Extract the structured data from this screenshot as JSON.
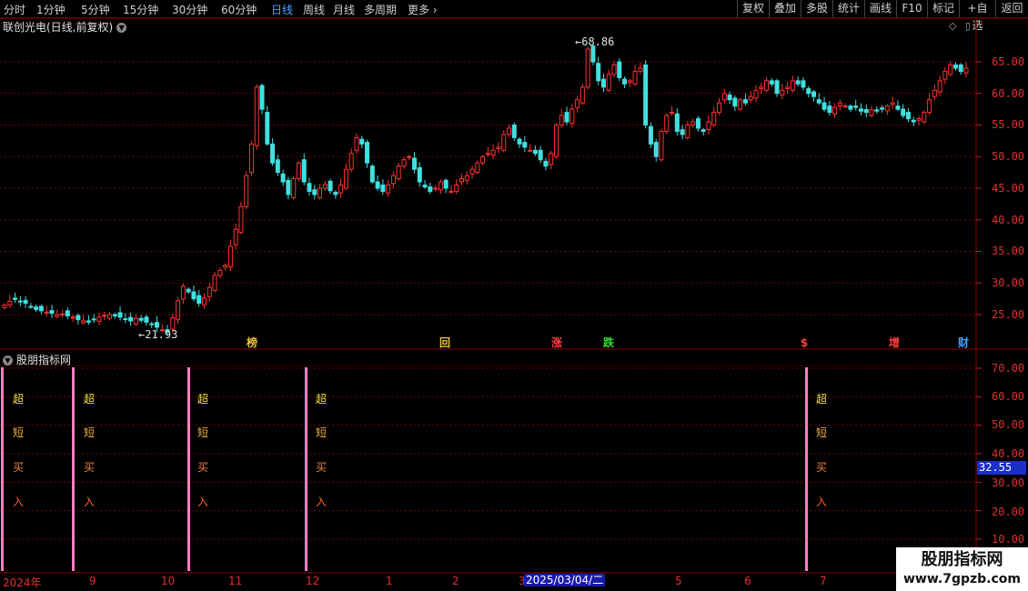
{
  "toolbar": {
    "periods": [
      "分时",
      "1分钟",
      "5分钟",
      "15分钟",
      "30分钟",
      "60分钟",
      "日线",
      "周线",
      "月线",
      "多周期",
      "更多"
    ],
    "active_period": "日线",
    "right_buttons": [
      "复权",
      "叠加",
      "多股",
      "统计",
      "画线",
      "F10",
      "标记",
      "+自选",
      "返回"
    ]
  },
  "chart_header": {
    "title": "联创光电(日线,前复权)"
  },
  "indicator_header": {
    "title": "股朋指标网"
  },
  "price_axis": [
    "65.00",
    "60.00",
    "55.00",
    "50.00",
    "45.00",
    "40.00",
    "35.00",
    "30.00",
    "25.00"
  ],
  "indicator_axis": [
    "70.00",
    "60.00",
    "50.00",
    "40.00",
    "30.00",
    "20.00",
    "10.00"
  ],
  "cursor_value": "32.55",
  "high_note": "68.86",
  "low_note": "21.93",
  "event_badges": [
    {
      "label": "榜",
      "color": "#e8c040"
    },
    {
      "label": "回",
      "color": "#e8c040"
    },
    {
      "label": "涨",
      "color": "#ff4040"
    },
    {
      "label": "跌",
      "color": "#30e030"
    },
    {
      "label": "$",
      "color": "#ff4040"
    },
    {
      "label": "增",
      "color": "#ff4040"
    },
    {
      "label": "财",
      "color": "#40a0ff"
    }
  ],
  "signal_text": [
    "超",
    "短",
    "买",
    "入"
  ],
  "signal_colors": [
    "#f0e040",
    "#f0b040",
    "#f08040",
    "#f06030"
  ],
  "x_axis": [
    "2024年",
    "9",
    "10",
    "11",
    "12",
    "1",
    "2",
    "3",
    "4",
    "5",
    "6",
    "7"
  ],
  "cursor_date": "2025/03/04/二",
  "watermark": {
    "line1": "股朋指标网",
    "line2": "www.7gpzb.com"
  },
  "colors": {
    "up": "#ff3030",
    "down": "#40e0e0",
    "grid": "#7a0000",
    "signal_bar": "#ff80c0"
  },
  "chart_data": {
    "type": "candlestick",
    "ylim": [
      20,
      70
    ],
    "price_closes": [
      26.5,
      27.1,
      27.4,
      27.0,
      26.8,
      26.2,
      25.8,
      25.6,
      25.4,
      25.2,
      25.0,
      25.1,
      24.8,
      24.6,
      24.2,
      24.0,
      23.8,
      24.2,
      24.6,
      24.9,
      25.0,
      24.8,
      24.6,
      24.3,
      24.0,
      24.4,
      24.1,
      23.8,
      23.5,
      23.0,
      22.6,
      22.2,
      24.5,
      27.2,
      29.5,
      28.6,
      27.5,
      26.8,
      27.6,
      29.3,
      31.2,
      32.0,
      32.8,
      35.8,
      38.5,
      42.1,
      47.0,
      52.0,
      61.0,
      57.5,
      52.0,
      49.0,
      47.5,
      46.0,
      44.0,
      46.5,
      49.0,
      46.0,
      44.5,
      44.0,
      45.0,
      45.6,
      44.6,
      44.0,
      45.5,
      48.0,
      50.5,
      53.0,
      52.0,
      49.0,
      46.0,
      45.0,
      44.5,
      45.5,
      47.0,
      48.5,
      49.5,
      50.0,
      48.0,
      46.0,
      45.2,
      44.5,
      45.0,
      46.0,
      45.0,
      44.5,
      45.5,
      46.5,
      47.0,
      48.0,
      49.0,
      50.0,
      50.5,
      51.0,
      51.5,
      53.5,
      54.5,
      53.0,
      52.0,
      51.5,
      51.0,
      50.5,
      49.5,
      48.5,
      50.5,
      55.0,
      56.5,
      55.5,
      57.5,
      59.0,
      61.0,
      67.0,
      65.0,
      62.0,
      61.0,
      63.0,
      64.5,
      62.5,
      61.5,
      62.0,
      63.5,
      64.0,
      55.0,
      52.0,
      50.0,
      54.0,
      56.5,
      57.0,
      54.0,
      53.5,
      55.0,
      55.5,
      54.5,
      54.0,
      55.5,
      57.0,
      58.5,
      60.0,
      59.0,
      58.0,
      59.0,
      58.5,
      59.5,
      60.5,
      61.0,
      62.0,
      61.5,
      60.0,
      60.5,
      61.0,
      62.0,
      61.5,
      61.0,
      60.0,
      59.5,
      58.5,
      57.5,
      57.0,
      57.8,
      58.5,
      58.0,
      57.5,
      57.8,
      57.2,
      57.0,
      57.4,
      57.2,
      57.5,
      58.0,
      58.5,
      57.5,
      56.5,
      56.0,
      55.5,
      56.0,
      57.0,
      59.0,
      60.5,
      62.0,
      63.5,
      64.5,
      64.0,
      63.5,
      64.0
    ]
  }
}
